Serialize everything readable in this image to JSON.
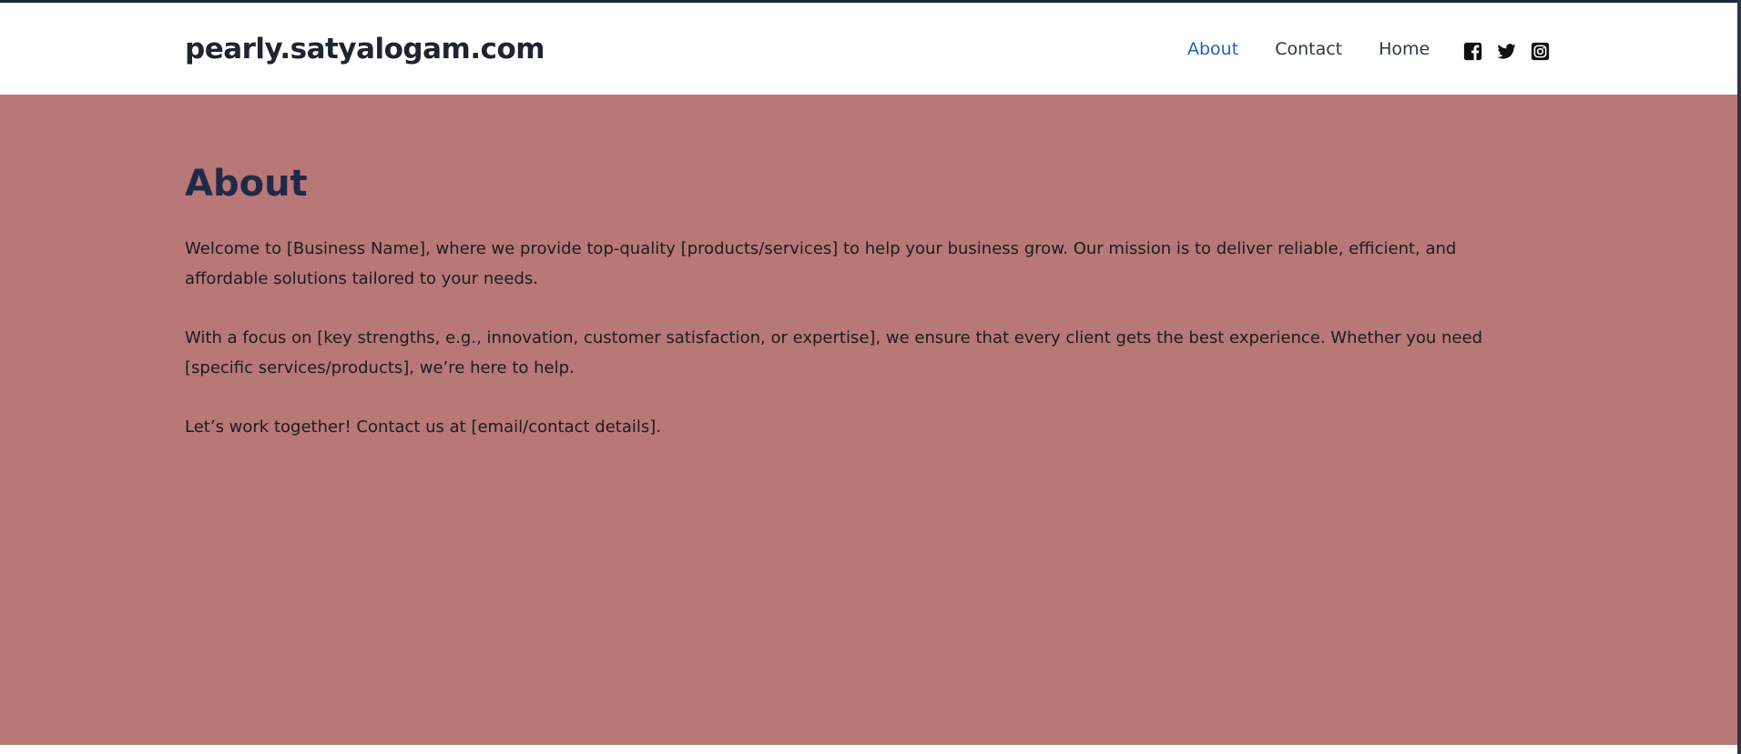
{
  "site": {
    "title": "pearly.satyalogam.com"
  },
  "nav": {
    "items": [
      {
        "label": "About",
        "active": true
      },
      {
        "label": "Contact",
        "active": false
      },
      {
        "label": "Home",
        "active": false
      }
    ]
  },
  "social": {
    "icons": [
      "facebook-icon",
      "twitter-icon",
      "instagram-icon"
    ]
  },
  "main": {
    "heading": "About",
    "paragraphs": [
      "Welcome to [Business Name], where we provide top-quality [products/services] to help your business grow. Our mission is to deliver reliable, efficient, and affordable solutions tailored to your needs.",
      "With a focus on [key strengths, e.g., innovation, customer satisfaction, or expertise], we ensure that every client gets the best experience. Whether you need [specific services/products], we’re here to help.",
      "Let’s work together! Contact us at [email/contact details]."
    ]
  },
  "colors": {
    "background": "#b87878",
    "nav_active": "#2464b4",
    "heading": "#1f2a44"
  }
}
